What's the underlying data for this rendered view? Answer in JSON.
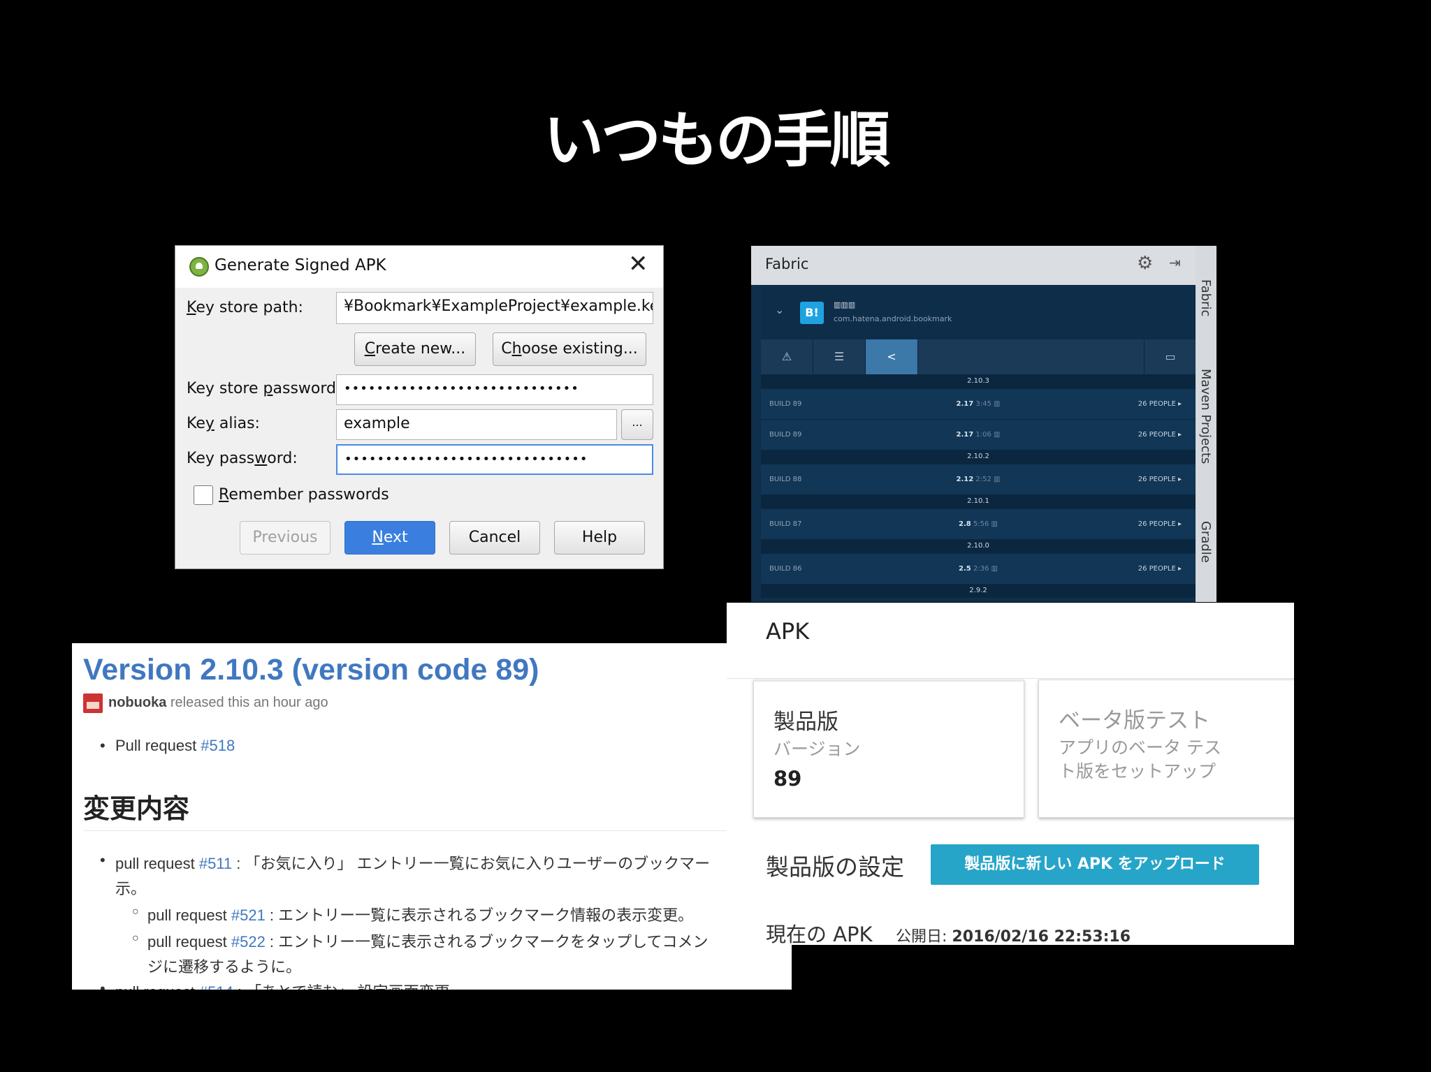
{
  "slide": {
    "title": "いつもの手順"
  },
  "signing_dialog": {
    "title": "Generate Signed APK",
    "key_store_path_label_pre": "",
    "key_store_path_label_k": "K",
    "key_store_path_label_rest": "ey store path:",
    "key_store_path": "¥Bookmark¥ExampleProject¥example.key",
    "create_new_k": "C",
    "create_new_rest": "reate new...",
    "choose_existing_pre": "C",
    "choose_existing_h": "h",
    "choose_existing_rest": "oose existing...",
    "key_store_password_pre": "Key store ",
    "key_store_password_p": "p",
    "key_store_password_rest": "assword:",
    "key_store_password_value": "•••••••••••••••••••••••••••••",
    "key_alias_pre": "Ke",
    "key_alias_y": "y",
    "key_alias_rest": " alias:",
    "key_alias_value": "example",
    "browse_label": "...",
    "key_password_pre": "Key pass",
    "key_password_w": "w",
    "key_password_rest": "ord:",
    "key_password_value": "••••••••••••••••••••••••••••••",
    "remember_r": "R",
    "remember_rest": "emember passwords",
    "previous_label": "Previous",
    "next_n": "N",
    "next_rest": "ext",
    "cancel_label": "Cancel",
    "help_label": "Help"
  },
  "fabric": {
    "panel_title": "Fabric",
    "side_tabs": [
      "Fabric",
      "Maven Projects",
      "Gradle"
    ],
    "badge": "B!",
    "app_name": "▥▥▥",
    "app_id": "com.hatena.android.bookmark",
    "tab_icons": [
      "warning-icon",
      "list-icon",
      "share-icon",
      "device-icon"
    ],
    "builds": [
      {
        "section": "2.10.3"
      },
      {
        "build": "BUILD 89",
        "version": "2.17",
        "time": "3:45 ▥",
        "people": "26 PEOPLE ▸"
      },
      {
        "build": "BUILD 89",
        "version": "2.17",
        "time": "1:06 ▥",
        "people": "26 PEOPLE ▸"
      },
      {
        "section": "2.10.2"
      },
      {
        "build": "BUILD 88",
        "version": "2.12",
        "time": "2:52 ▥",
        "people": "26 PEOPLE ▸"
      },
      {
        "section": "2.10.1"
      },
      {
        "build": "BUILD 87",
        "version": "2.8",
        "time": "5:56 ▥",
        "people": "26 PEOPLE ▸"
      },
      {
        "section": "2.10.0"
      },
      {
        "build": "BUILD 86",
        "version": "2.5",
        "time": "2:36 ▥",
        "people": "26 PEOPLE ▸"
      },
      {
        "section": "2.9.2"
      }
    ]
  },
  "release": {
    "title": "Version 2.10.3 (version code 89)",
    "author": "nobuoka",
    "released_text": " released this an hour ago",
    "pr_label": "Pull request ",
    "pr_number": "#518",
    "changes_heading": "変更内容",
    "items": [
      {
        "pre": "pull request ",
        "num": "#511",
        "text": " : 「お気に入り」 エントリー一覧にお気に入りユーザーのブックマー",
        "cont": "示。"
      },
      {
        "pre": "pull request ",
        "num": "#521",
        "text": " : エントリー一覧に表示されるブックマーク情報の表示変更。"
      },
      {
        "pre": "pull request ",
        "num": "#522",
        "text": " : エントリー一覧に表示されるブックマークをタップしてコメン",
        "cont": "ジに遷移するように。"
      },
      {
        "pre": "pull request ",
        "num": "#514",
        "text": " : 「あとで読む」 設定画面変更"
      }
    ]
  },
  "play_console": {
    "section_title": "APK",
    "production_title": "製品版",
    "production_sub": "バージョン",
    "production_version": "89",
    "beta_title": "ベータ版テスト",
    "beta_sub_1": "アプリのベータ テス",
    "beta_sub_2": "ト版をセットアップ",
    "settings_title": "製品版の設定",
    "upload_button": "製品版に新しい APK をアップロード",
    "current_apk": "現在の APK",
    "published_label": "公開日: ",
    "published_date": "2016/02/16 22:53:16"
  },
  "colors": {
    "background": "#000000",
    "link": "#4078c0",
    "primary_button": "#3a7fe0",
    "upload_button": "#26a5c9",
    "fabric_bg": "#0f2f4c"
  }
}
